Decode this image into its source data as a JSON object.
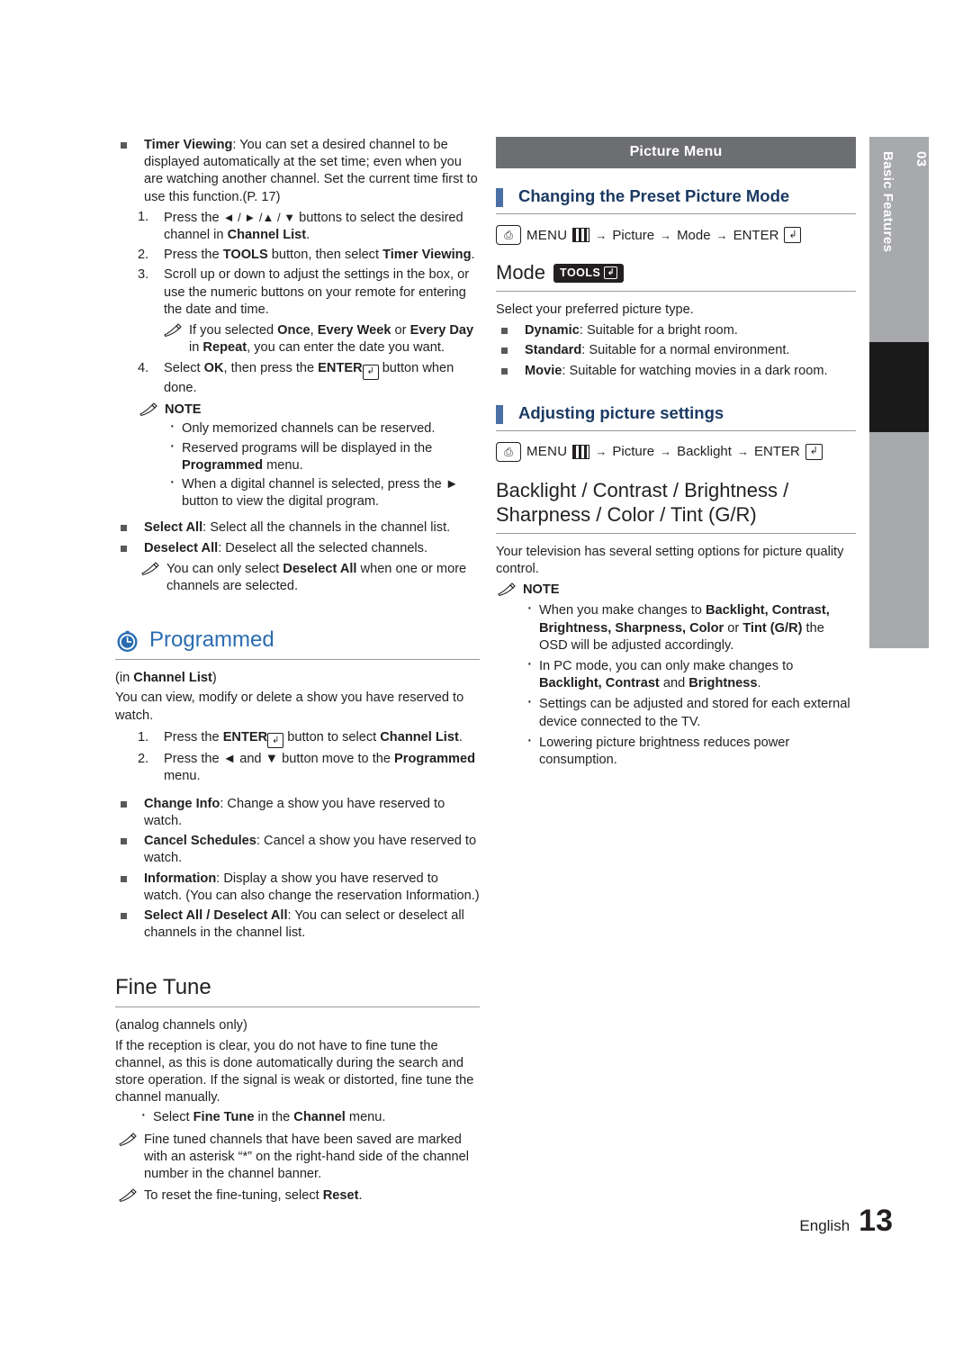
{
  "side_tab": {
    "number": "03",
    "label": "Basic Features"
  },
  "footer": {
    "language": "English",
    "page": "13"
  },
  "left_column": {
    "timer_viewing": {
      "title": "Timer Viewing",
      "body": ": You can set a desired channel to be displayed automatically at the set time; even when you are watching another channel. Set the current time first to use this function.(P. 17)",
      "steps": [
        {
          "num": "1.",
          "html_parts": [
            "Press the ",
            "◄ / ► /▲ / ▼",
            " buttons to select the desired channel in ",
            "Channel List",
            "."
          ]
        },
        {
          "num": "2.",
          "html_parts": [
            "Press the ",
            "TOOLS",
            " button, then select ",
            "Timer Viewing",
            "."
          ]
        },
        {
          "num": "3.",
          "html_parts": [
            "Scroll up or down to adjust the settings in the box, or use the numeric buttons on your remote for entering the date and time."
          ]
        },
        {
          "num": "4.",
          "html_parts": [
            "Select ",
            "OK",
            ", then press the ",
            "ENTER",
            " button when done."
          ]
        }
      ],
      "step3_note": {
        "pre": "If you selected ",
        "b1": "Once",
        "mid1": ", ",
        "b2": "Every Week",
        "mid2": " or ",
        "b3": "Every Day",
        "mid3": " in ",
        "b4": "Repeat",
        "post": ", you can enter the date you want."
      },
      "note_label": "NOTE",
      "notes": [
        {
          "text": "Only memorized channels can be reserved."
        },
        {
          "pre": "Reserved programs will be displayed in the ",
          "b": "Programmed",
          "post": " menu."
        },
        {
          "pre": "When a digital channel is selected, press the ► button to view the digital program.",
          "b": "",
          "post": ""
        }
      ]
    },
    "select_all": {
      "title": "Select All",
      "body": ": Select all the channels in the channel list."
    },
    "deselect_all": {
      "title": "Deselect All",
      "body": ": Deselect all the selected channels."
    },
    "deselect_note": {
      "pre": "You can only select ",
      "b": "Deselect All",
      "post": " when one or more channels are selected."
    },
    "programmed": {
      "heading": "Programmed",
      "subtitle_pre": "(in ",
      "subtitle_b": "Channel List",
      "subtitle_post": ")",
      "intro": "You can view, modify or delete a show you have reserved to watch.",
      "steps": [
        {
          "num": "1.",
          "pre": "Press the ",
          "ico": "ENTER",
          "mid": " button to select ",
          "b": "Channel List",
          "post": "."
        },
        {
          "num": "2.",
          "pre": "Press the ◄ and ▼ button move to the ",
          "b": "Programmed",
          "post": " menu."
        }
      ],
      "items": [
        {
          "title": "Change Info",
          "body": ": Change a show you have reserved to watch."
        },
        {
          "title": "Cancel Schedules",
          "body": ": Cancel a show you have reserved to watch."
        },
        {
          "title": "Information",
          "body": ": Display a show you have reserved to watch. (You can also change the reservation Information.)"
        },
        {
          "title": "Select All / Deselect All",
          "body": ": You can select or deselect all channels in the channel list."
        }
      ]
    },
    "fine_tune": {
      "heading": "Fine Tune",
      "subtitle": "(analog channels only)",
      "body": "If the reception is clear, you do not have to fine tune the channel, as this is done automatically during the search and store operation. If the signal is weak or distorted, fine tune the channel manually.",
      "bullet": {
        "pre": "Select ",
        "b1": "Fine Tune",
        "mid": " in the ",
        "b2": "Channel",
        "post": " menu."
      },
      "notes": [
        "Fine tuned channels that have been saved are marked with an asterisk “*” on the right-hand side of the channel number in the channel banner.",
        "To reset the fine-tuning, select Reset."
      ],
      "note2_pre": "To reset the fine-tuning, select ",
      "note2_b": "Reset",
      "note2_post": "."
    }
  },
  "right_column": {
    "banner": "Picture Menu",
    "heading1": "Changing the Preset Picture Mode",
    "path1": {
      "menu_word": "MENU",
      "p1": "Picture",
      "p2": "Mode",
      "enter_word": "ENTER"
    },
    "mode": {
      "title": "Mode",
      "tools": "TOOLS",
      "intro": "Select your preferred picture type.",
      "items": [
        {
          "b": "Dynamic",
          "text": ": Suitable for a bright room."
        },
        {
          "b": "Standard",
          "text": ": Suitable for a normal environment."
        },
        {
          "b": "Movie",
          "text": ": Suitable for watching movies in a dark room."
        }
      ]
    },
    "heading2": "Adjusting picture settings",
    "path2": {
      "menu_word": "MENU",
      "p1": "Picture",
      "p2": "Backlight",
      "enter_word": "ENTER"
    },
    "heading3_line1": "Backlight / Contrast / Brightness /",
    "heading3_line2": "Sharpness / Color / Tint (G/R)",
    "intro": "Your television has several setting options for picture quality control.",
    "note_label": "NOTE",
    "notes": [
      {
        "pre": "When you make changes to ",
        "b1": "Backlight, Contrast, Brightness, Sharpness, Color",
        "mid": " or ",
        "b2": "Tint (G/R)",
        "post": " the OSD will be adjusted accordingly."
      },
      {
        "pre": "In PC mode, you can only make changes to ",
        "b1": "Backlight, Contrast",
        "mid": " and ",
        "b2": "Brightness",
        "post": "."
      },
      {
        "pre": "Settings can be adjusted and stored for each external device connected to the TV.",
        "b1": "",
        "mid": "",
        "b2": "",
        "post": ""
      },
      {
        "pre": "Lowering picture brightness reduces power consumption.",
        "b1": "",
        "mid": "",
        "b2": "",
        "post": ""
      }
    ]
  }
}
